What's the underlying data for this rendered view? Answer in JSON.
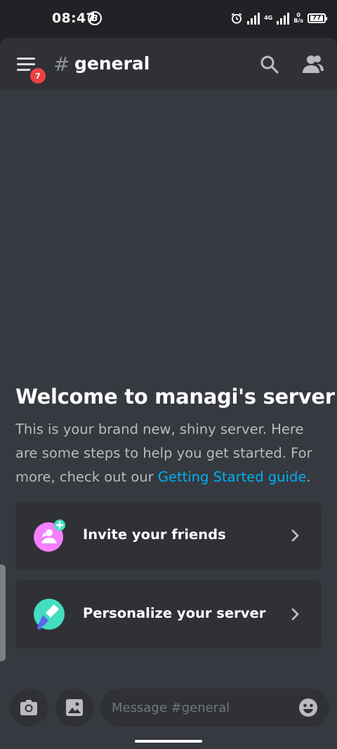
{
  "status_bar": {
    "time": "08:47",
    "net_label_top": "4G",
    "speed_value": "0",
    "speed_unit": "B/s",
    "battery": "77"
  },
  "header": {
    "hash": "#",
    "channel_name": "general",
    "notification_count": "7"
  },
  "welcome": {
    "title": "Welcome to managi's server",
    "body_before_link": "This is your brand new, shiny server. Here are some steps to help you get started. For more, check out our ",
    "link_text": "Getting Started guide",
    "body_after_link": "."
  },
  "cards": {
    "invite_label": "Invite your friends",
    "personalize_label": "Personalize your server"
  },
  "composer": {
    "placeholder": "Message #general"
  },
  "colors": {
    "background": "#36393f",
    "header": "#2f3136",
    "badge": "#ed4245",
    "link": "#00aff4",
    "invite_icon": "#f47fff",
    "personalize_icon": "#45ddc0"
  }
}
